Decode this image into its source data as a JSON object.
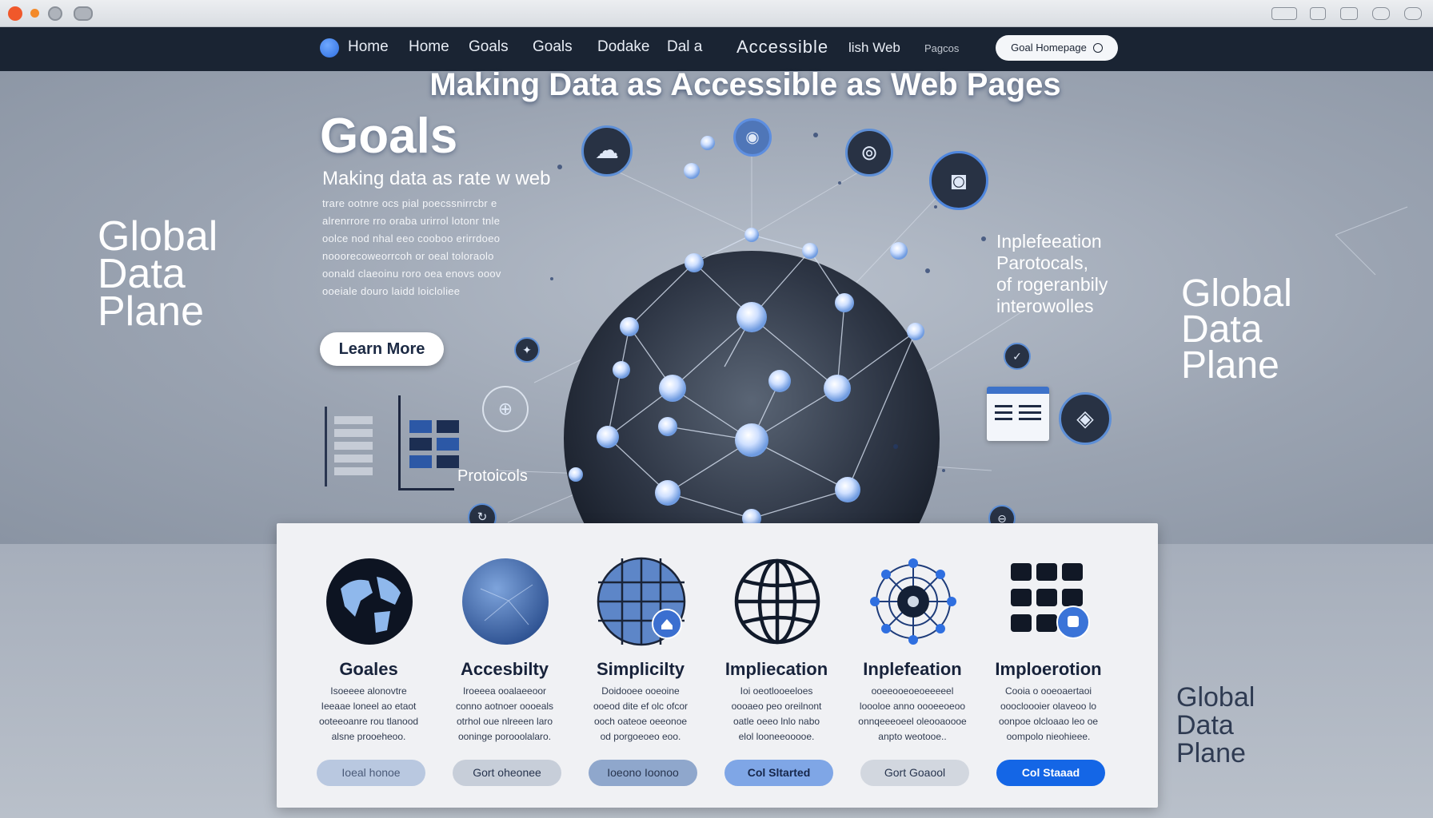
{
  "window": {
    "controls": [
      "close",
      "minimize",
      "maximize",
      "tab-view"
    ]
  },
  "nav": {
    "links": [
      "Home",
      "Home",
      "Goals",
      "Goals",
      "Dodake",
      "Dal a",
      "Accessible",
      "lish Web",
      "Pagcos"
    ],
    "cta_label": "Goal Homepage"
  },
  "hero": {
    "headline": "Making Data as Accessible as Web Pages",
    "goals_title": "Goals",
    "goals_subtitle": "Making data as rate w web",
    "goals_body": [
      "trare ootnre ocs pial poecssnirrcbr e",
      "alrenrrore rro oraba urirrol lotonr tnle",
      "oolce nod nhal eeo cooboo erirrdoeo",
      "nooorecoweorrcoh or oeal toloraolo",
      "oonald claeoinu roro oea enovs ooov",
      "ooeiale douro laidd loicloliee"
    ],
    "learn_more": "Learn More",
    "left_label": [
      "Global",
      "Data",
      "Plane"
    ],
    "right_label": [
      "Global",
      "Data",
      "Plane"
    ],
    "bottom_label": [
      "Global",
      "Data",
      "Plane"
    ],
    "right_note": [
      "Inplefeeation",
      "Parotocals,",
      "of rogeranbily",
      "interowolles"
    ],
    "protocols": "Protoicols"
  },
  "cards": [
    {
      "title": "Goales",
      "icon": "globe-dark-icon",
      "desc": [
        "Isoeeee alonovtre",
        "Ieeaae loneel ao etaot",
        "ooteeoanre rou tlanood",
        "alsne prooeheoo."
      ],
      "button": "Ioeal honoe",
      "button_style": "muted"
    },
    {
      "title": "Accesbilty",
      "icon": "globe-blue-icon",
      "desc": [
        "Iroeeea ooalaeeoor",
        "conno aotnoer oooeals",
        "otrhol oue nlreeen laro",
        "ooninge porooolalaro."
      ],
      "button": "Gort oheonee",
      "button_style": "light"
    },
    {
      "title": "Simplicilty",
      "icon": "grid-globe-icon",
      "desc": [
        "Doidooee ooeoine",
        "ooeod dite ef olc ofcor",
        "ooch oateoe oeeonoe",
        "od porgoeoeo eoo."
      ],
      "button": "Ioeono Ioonoo",
      "button_style": "medium"
    },
    {
      "title": "Impliecation",
      "icon": "wire-globe-icon",
      "desc": [
        "Ioi oeotlooeeloes",
        "oooaeo peo oreilnont",
        "oatle oeeo lnlo nabo",
        "elol looneeooooe."
      ],
      "button": "Col Sltarted",
      "button_style": "accent"
    },
    {
      "title": "Inplefeation",
      "icon": "network-node-icon",
      "desc": [
        "ooeeooeoeoeeeeel",
        "loooloe anno oooeeoeoo",
        "onnqeeeoeel oleooaoooe",
        "anpto weotooe.."
      ],
      "button": "Gort Goaool",
      "button_style": "light"
    },
    {
      "title": "Imploerotion",
      "icon": "database-blocks-icon",
      "desc": [
        "Cooia o ooeoaertaoi",
        "ooocloooier olaveoo lo",
        "oonpoe olcloaao leo oe",
        "oompolo nieohieee."
      ],
      "button": "Col Staaad",
      "button_style": "primary"
    }
  ],
  "colors": {
    "navbar": "#1a2433",
    "accent_blue": "#1466e6",
    "card_panel": "#f0f1f4",
    "dark_text": "#17223a"
  }
}
